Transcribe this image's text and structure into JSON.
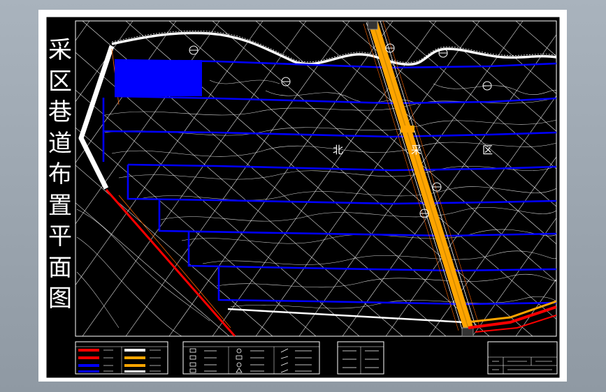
{
  "drawing": {
    "vertical_title_chars": [
      "采",
      "区",
      "巷",
      "道",
      "布",
      "置",
      "平",
      "面",
      "图"
    ],
    "zone_label_chars": [
      "北",
      "采",
      "区"
    ]
  },
  "colors": {
    "background": "#000000",
    "sheet": "#ffffff",
    "roadway_blue": "#0000ff",
    "fault_red": "#ff0000",
    "main_shaft_orange": "#ffa500",
    "boundary_white": "#ffffff"
  }
}
